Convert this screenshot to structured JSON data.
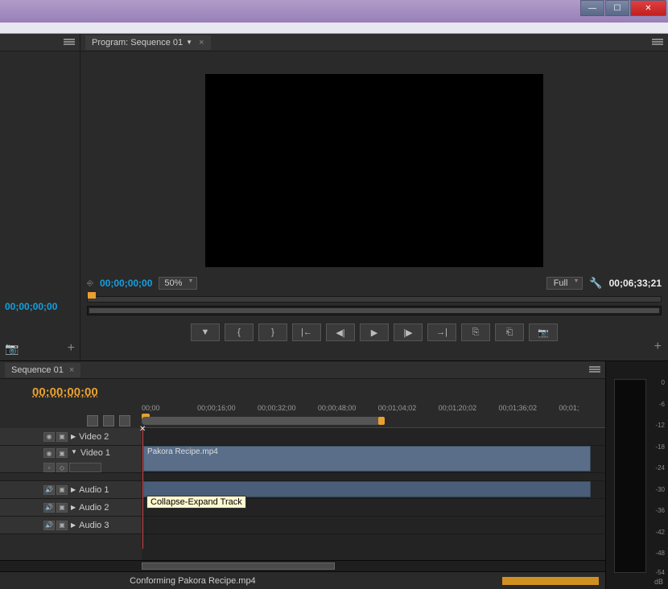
{
  "window": {
    "minimize": "—",
    "maximize": "☐",
    "close": "✕"
  },
  "program": {
    "tab_label": "Program: Sequence 01",
    "timecode_left": "00;00;00;00",
    "zoom": "50%",
    "quality": "Full",
    "duration": "00;06;33;21"
  },
  "source": {
    "timecode": "00;00;00;00"
  },
  "transport": {
    "mark_in": "▼",
    "in_point": "{",
    "out_point": "}",
    "goto_in": "|←",
    "step_back": "◀|",
    "play": "▶",
    "step_fwd": "|▶",
    "goto_out": "→|",
    "lift": "⎘",
    "extract": "⎗",
    "export_frame": "📷"
  },
  "timeline": {
    "tab_label": "Sequence 01",
    "timecode": "00;00;00;00",
    "ruler": [
      "00;00",
      "00;00;16;00",
      "00;00;32;00",
      "00;00;48;00",
      "00;01;04;02",
      "00;01;20;02",
      "00;01;36;02",
      "00;01;"
    ],
    "tracks": {
      "video2": "Video 2",
      "video1": "Video 1",
      "audio1": "Audio 1",
      "audio2": "Audio 2",
      "audio3": "Audio 3"
    },
    "clip_name": "Pakora Recipe.mp4",
    "tooltip": "Collapse-Expand Track"
  },
  "status": {
    "text": "Conforming Pakora Recipe.mp4"
  },
  "meter": {
    "ticks": [
      "0",
      "-6",
      "-12",
      "-18",
      "-24",
      "-30",
      "-36",
      "-42",
      "-48",
      "-54"
    ],
    "unit": "dB"
  }
}
